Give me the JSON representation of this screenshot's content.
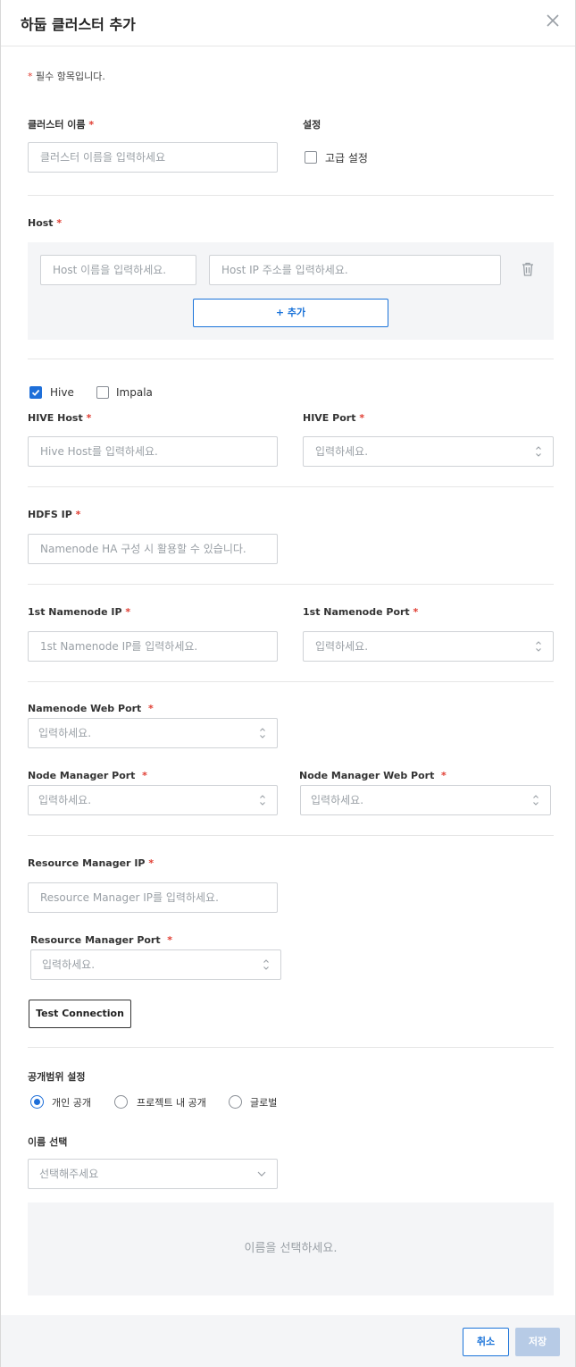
{
  "title": "하둡 클러스터 추가",
  "required_note": "필수 항목입니다.",
  "cluster_name": {
    "label": "클러스터 이름",
    "placeholder": "클러스터 이름을 입력하세요"
  },
  "settings": {
    "label": "설정",
    "advanced_label": "고급 설정",
    "advanced_checked": false
  },
  "host": {
    "label": "Host",
    "name_placeholder": "Host 이름을 입력하세요.",
    "ip_placeholder": "Host IP 주소를 입력하세요.",
    "add_label": "+ 추가"
  },
  "engines": {
    "hive_label": "Hive",
    "hive_checked": true,
    "impala_label": "Impala",
    "impala_checked": false
  },
  "hive_host": {
    "label": "HIVE Host",
    "placeholder": "Hive Host를 입력하세요."
  },
  "hive_port": {
    "label": "HIVE Port",
    "placeholder": "입력하세요."
  },
  "hdfs_ip": {
    "label": "HDFS IP",
    "placeholder": "Namenode HA 구성 시 활용할 수 있습니다."
  },
  "namenode_ip": {
    "label": "1st Namenode IP",
    "placeholder": "1st Namenode IP를 입력하세요."
  },
  "namenode_port": {
    "label": "1st Namenode Port",
    "placeholder": "입력하세요."
  },
  "namenode_web_port": {
    "label": "Namenode Web Port",
    "placeholder": "입력하세요."
  },
  "node_manager_port": {
    "label": "Node Manager Port",
    "placeholder": "입력하세요."
  },
  "node_manager_web_port": {
    "label": "Node Manager Web Port",
    "placeholder": "입력하세요."
  },
  "resource_manager_ip": {
    "label": "Resource Manager IP",
    "placeholder": "Resource Manager IP를 입력하세요."
  },
  "resource_manager_port": {
    "label": "Resource Manager Port",
    "placeholder": "입력하세요."
  },
  "test_connection_label": "Test Connection",
  "visibility": {
    "label": "공개범위 설정",
    "options": [
      "개인 공개",
      "프로젝트 내 공개",
      "글로벌"
    ],
    "selected": "개인 공개"
  },
  "name_select": {
    "label": "이름 선택",
    "placeholder": "선택해주세요",
    "empty_message": "이름을 선택하세요."
  },
  "footer": {
    "cancel_label": "취소",
    "save_label": "저장"
  },
  "colors": {
    "accent": "#1e6fd9",
    "required": "#e03c31",
    "panel_bg": "#f4f5f7",
    "save_disabled": "#b7cbe6"
  },
  "icons": [
    "close-icon",
    "trash-icon",
    "spinner-arrows-icon",
    "chevron-down-icon",
    "check-icon"
  ]
}
